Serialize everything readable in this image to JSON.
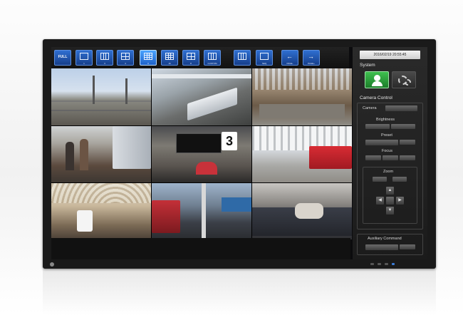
{
  "toolbar": {
    "buttons": [
      {
        "label": "FULL"
      },
      {
        "label": "1"
      },
      {
        "label": "3"
      },
      {
        "label": "4"
      },
      {
        "label": "9"
      },
      {
        "label": "16"
      },
      {
        "label": "8"
      },
      {
        "label": "CUSTOM"
      },
      {
        "label": ""
      },
      {
        "label": "SEQ"
      },
      {
        "label": "PAGE-"
      },
      {
        "label": "PAGE+"
      }
    ]
  },
  "panel": {
    "datetime": "2016/02/19 20:55:45",
    "system_title": "System",
    "camera_control_title": "Camera Control",
    "camera_label": "Camera",
    "brightness_label": "Brightness",
    "preset_label": "Preset",
    "focus_label": "Focus",
    "zoom_label": "Zoom",
    "auxiliary_label": "Auxiliary Command"
  },
  "grid": {
    "overlay_number": "3"
  },
  "icons": {
    "user": "user-icon",
    "settings": "gear-icon",
    "prev": "arrow-left-icon",
    "next": "arrow-right-icon"
  },
  "colors": {
    "accent_blue": "#2f6fd1",
    "active_blue": "#4aa3ff",
    "system_green": "#3fbf4f"
  }
}
